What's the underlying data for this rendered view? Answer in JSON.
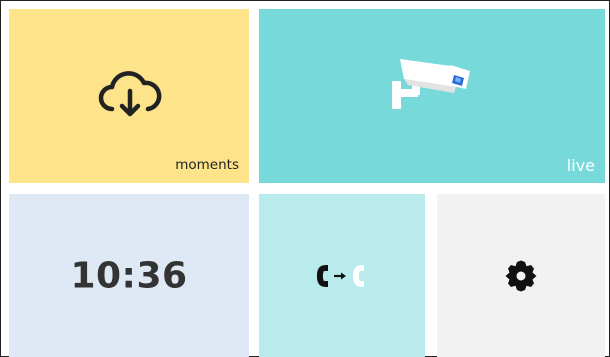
{
  "tiles": {
    "moments": {
      "label": "moments",
      "icon": "cloud-download-icon",
      "color": "#FDE38A"
    },
    "live": {
      "label": "live",
      "icon": "security-camera-icon",
      "color": "#77D9DA"
    },
    "clock": {
      "time": "10:36",
      "color": "#DFE9F5"
    },
    "call": {
      "icon": "call-transfer-icon",
      "color": "#B9EBEC"
    },
    "settings": {
      "icon": "gear-icon",
      "color": "#F2F2F2"
    }
  }
}
